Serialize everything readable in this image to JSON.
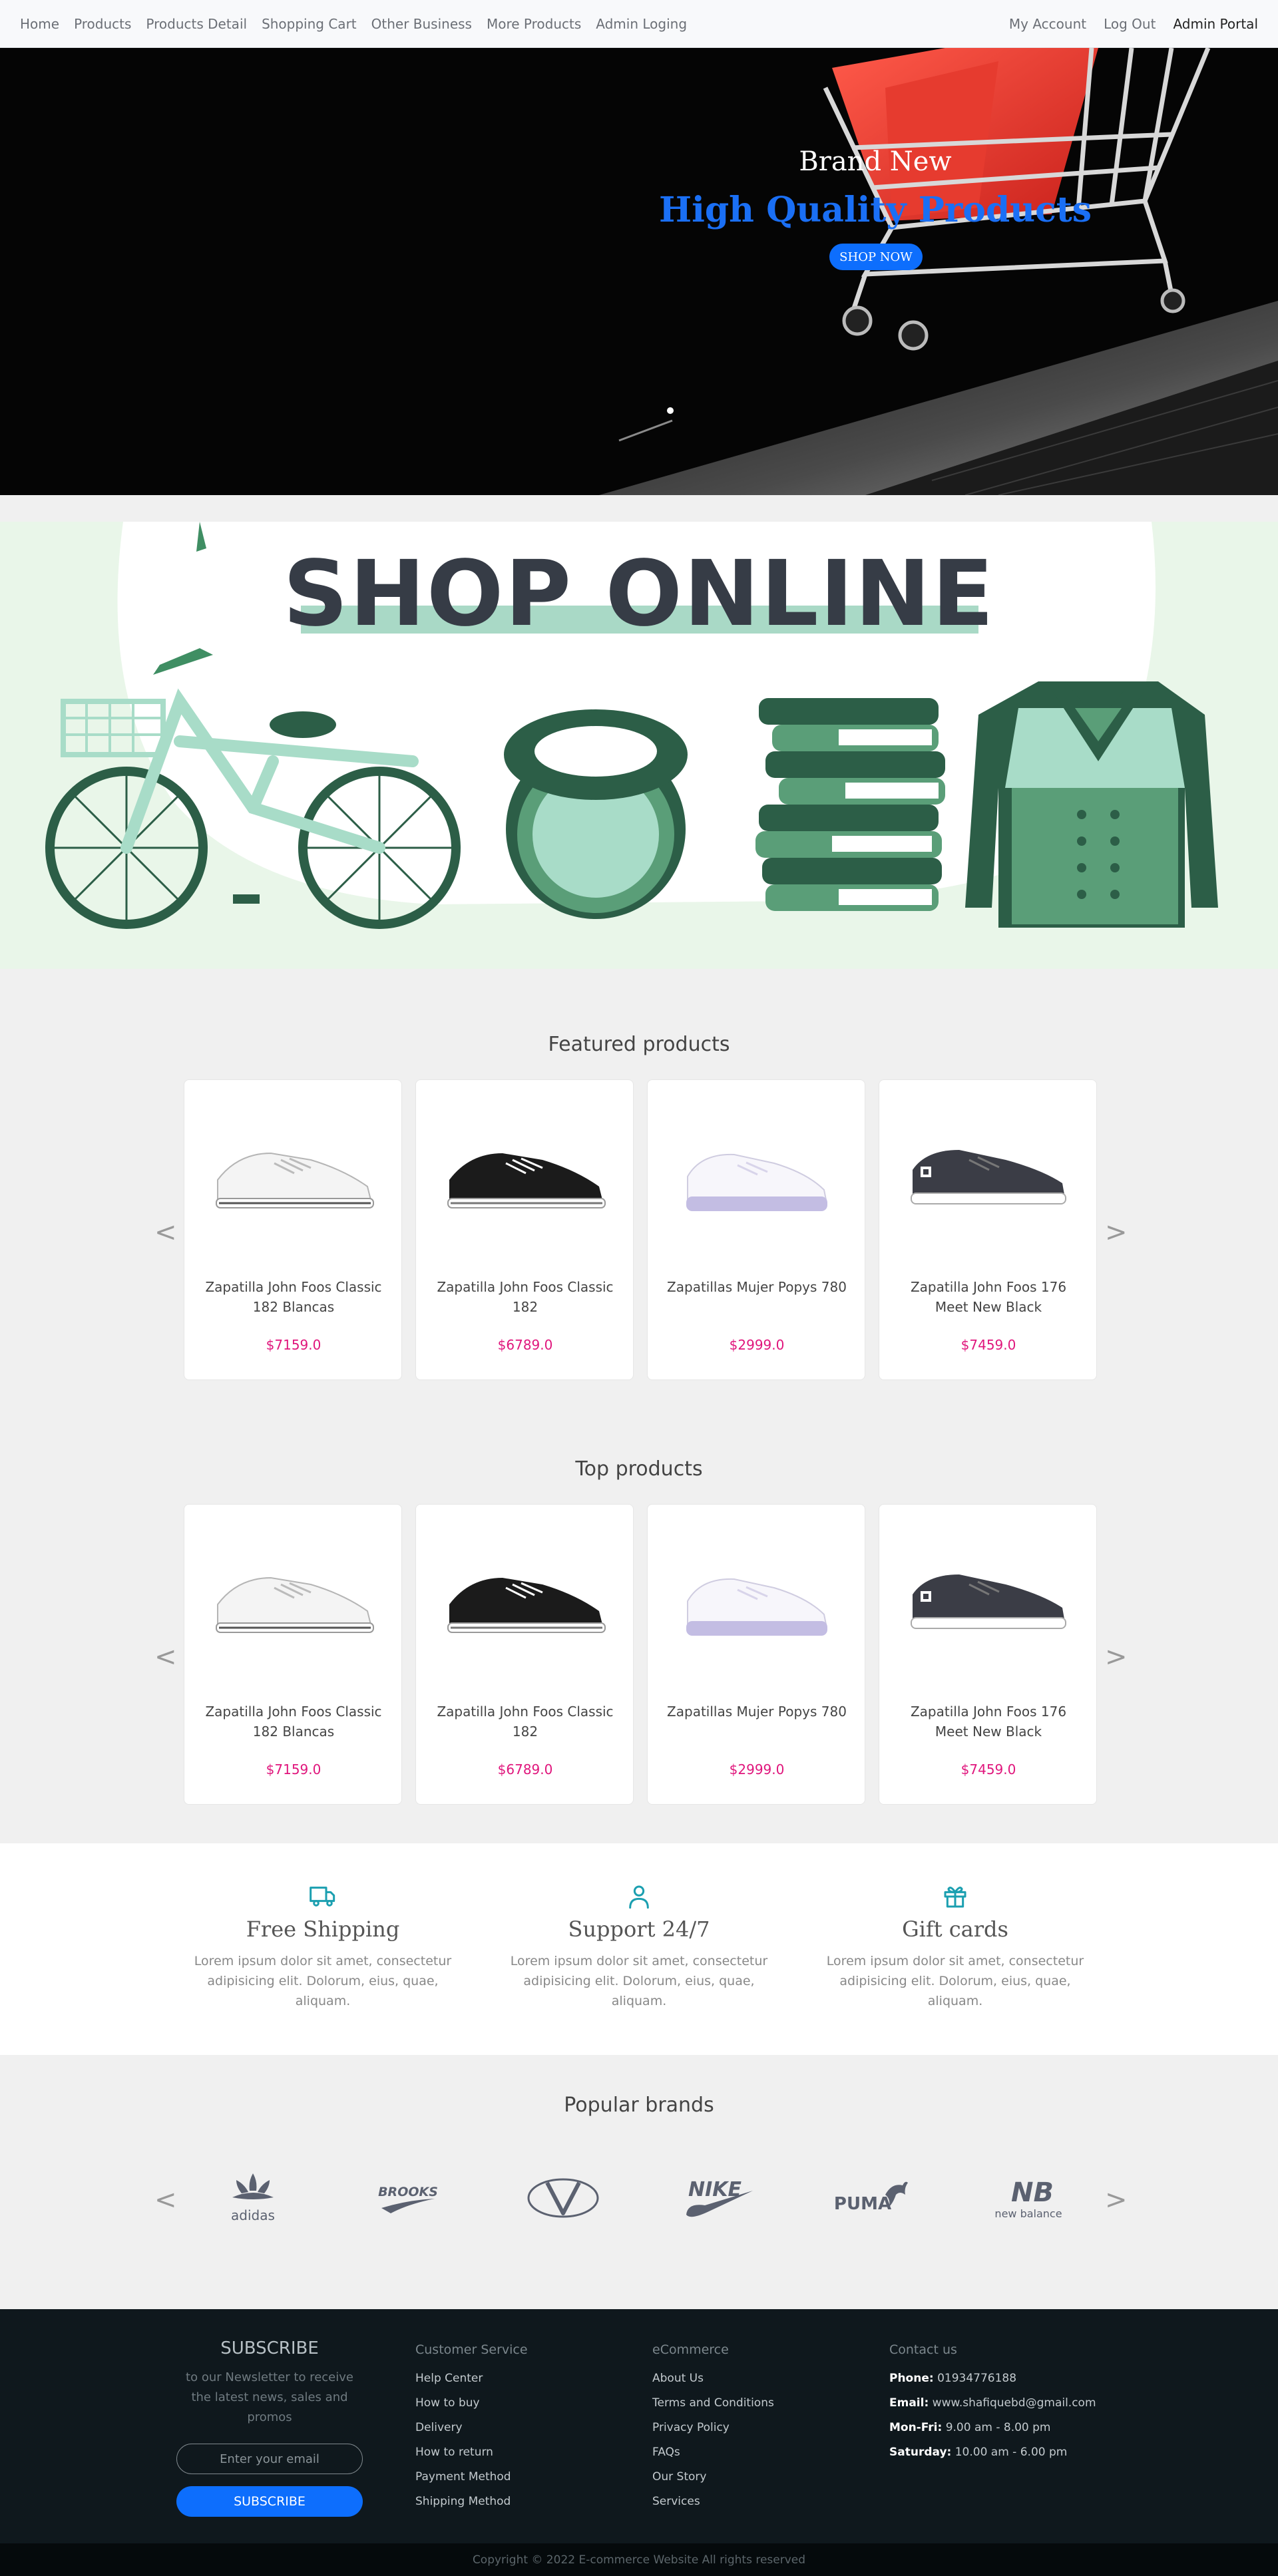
{
  "nav": {
    "left": [
      "Home",
      "Products",
      "Products Detail",
      "Shopping Cart",
      "Other Business",
      "More Products",
      "Admin Loging"
    ],
    "right": [
      "My Account",
      "Log Out",
      "Admin Portal"
    ]
  },
  "hero": {
    "line1": "Brand New",
    "line2": "High Quality Products",
    "button": "SHOP NOW"
  },
  "banner": {
    "title": "SHOP ONLINE"
  },
  "featured": {
    "title": "Featured products",
    "prev": "<",
    "next": ">",
    "items": [
      {
        "name": "Zapatilla John Foos Classic 182 Blancas",
        "price": "$7159.0",
        "shoe_color": "white"
      },
      {
        "name": "Zapatilla John Foos Classic 182",
        "price": "$6789.0",
        "shoe_color": "black"
      },
      {
        "name": "Zapatillas Mujer Popys 780",
        "price": "$2999.0",
        "shoe_color": "lavender"
      },
      {
        "name": "Zapatilla John Foos 176 Meet New Black",
        "price": "$7459.0",
        "shoe_color": "charcoal"
      }
    ]
  },
  "top": {
    "title": "Top products",
    "prev": "<",
    "next": ">",
    "items": [
      {
        "name": "Zapatilla John Foos Classic 182 Blancas",
        "price": "$7159.0",
        "shoe_color": "white"
      },
      {
        "name": "Zapatilla John Foos Classic 182",
        "price": "$6789.0",
        "shoe_color": "black"
      },
      {
        "name": "Zapatillas Mujer Popys 780",
        "price": "$2999.0",
        "shoe_color": "lavender"
      },
      {
        "name": "Zapatilla John Foos 176 Meet New Black",
        "price": "$7459.0",
        "shoe_color": "charcoal"
      }
    ]
  },
  "features": [
    {
      "icon": "truck-icon",
      "title": "Free Shipping",
      "text": "Lorem ipsum dolor sit amet, consectetur adipisicing elit. Dolorum, eius, quae, aliquam."
    },
    {
      "icon": "user-icon",
      "title": "Support 24/7",
      "text": "Lorem ipsum dolor sit amet, consectetur adipisicing elit. Dolorum, eius, quae, aliquam."
    },
    {
      "icon": "gift-icon",
      "title": "Gift cards",
      "text": "Lorem ipsum dolor sit amet, consectetur adipisicing elit. Dolorum, eius, quae, aliquam."
    }
  ],
  "brands": {
    "title": "Popular brands",
    "prev": "<",
    "next": ">",
    "logos": [
      "adidas",
      "BROOKS",
      "Valentino",
      "NIKE",
      "PUMA",
      "new balance"
    ]
  },
  "footer": {
    "subscribe_title": "SUBSCRIBE",
    "subscribe_text": "to our Newsletter to receive the latest news, sales and promos",
    "email_placeholder": "Enter your email",
    "subscribe_button": "SUBSCRIBE",
    "customer_service": {
      "heading": "Customer Service",
      "links": [
        "Help Center",
        "How to buy",
        "Delivery",
        "How to return",
        "Payment Method",
        "Shipping Method"
      ]
    },
    "ecommerce": {
      "heading": "eCommerce",
      "links": [
        "About Us",
        "Terms and Conditions",
        "Privacy Policy",
        "FAQs",
        "Our Story",
        "Services"
      ]
    },
    "contact": {
      "heading": "Contact us",
      "lines": [
        {
          "label": "Phone:",
          "value": "01934776188"
        },
        {
          "label": "Email:",
          "value": "www.shafiquebd@gmail.com"
        },
        {
          "label": "Mon-Fri:",
          "value": "9.00 am - 8.00 pm"
        },
        {
          "label": "Saturday:",
          "value": "10.00 am - 6.00 pm"
        }
      ]
    },
    "copyright": "Copyright © 2022 E-commerce Website All rights reserved"
  },
  "colors": {
    "accent": "#0d6efd",
    "price": "#e0157c",
    "hero_title": "#1a6ff5",
    "banner_bg": "#e9f6e9",
    "footer_bg": "#0f181d"
  }
}
